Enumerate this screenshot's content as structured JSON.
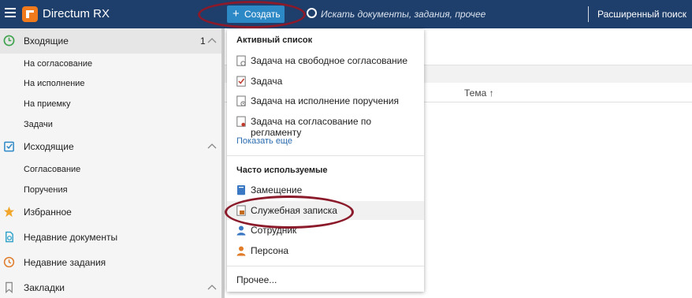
{
  "app": {
    "title": "Directum RX"
  },
  "header": {
    "create_label": "Создать",
    "search_placeholder": "Искать документы, задания, прочее",
    "advanced_search_label": "Расширенный поиск"
  },
  "sidebar": {
    "sections": [
      {
        "label": "Входящие",
        "count": "1",
        "icon": "clock-icon"
      },
      {
        "label": "Исходящие",
        "icon": "checklist-icon"
      },
      {
        "label": "Избранное",
        "icon": "star-icon"
      },
      {
        "label": "Недавние документы",
        "icon": "recent-documents-icon"
      },
      {
        "label": "Недавние задания",
        "icon": "recent-tasks-icon"
      },
      {
        "label": "Закладки",
        "icon": "bookmark-icon"
      }
    ],
    "incoming_items": [
      "На согласование",
      "На исполнение",
      "На приемку",
      "Задачи"
    ],
    "outgoing_items": [
      "Согласование",
      "Поручения"
    ]
  },
  "main": {
    "column_subject": "Тема ↑"
  },
  "dropdown": {
    "active_heading": "Активный список",
    "active_items": [
      {
        "label": "Задача на свободное согласование",
        "icon": "approval-task-icon"
      },
      {
        "label": "Задача",
        "icon": "task-icon"
      },
      {
        "label": "Задача на исполнение поручения",
        "icon": "action-item-task-icon"
      },
      {
        "label": "Задача на согласование по регламенту",
        "icon": "regulation-approval-task-icon"
      }
    ],
    "show_more_label": "Показать еще",
    "frequent_heading": "Часто используемые",
    "frequent_items": [
      {
        "label": "Замещение",
        "icon": "substitution-icon"
      },
      {
        "label": "Служебная записка",
        "icon": "memo-icon"
      },
      {
        "label": "Сотрудник",
        "icon": "employee-icon"
      },
      {
        "label": "Персона",
        "icon": "person-icon"
      }
    ],
    "other_label": "Прочее..."
  },
  "colors": {
    "header_bg": "#1e3e6b",
    "create_button": "#2d88c6",
    "logo": "#f07a1c",
    "annotation": "#8b1a2a",
    "link": "#2b6cb0"
  }
}
